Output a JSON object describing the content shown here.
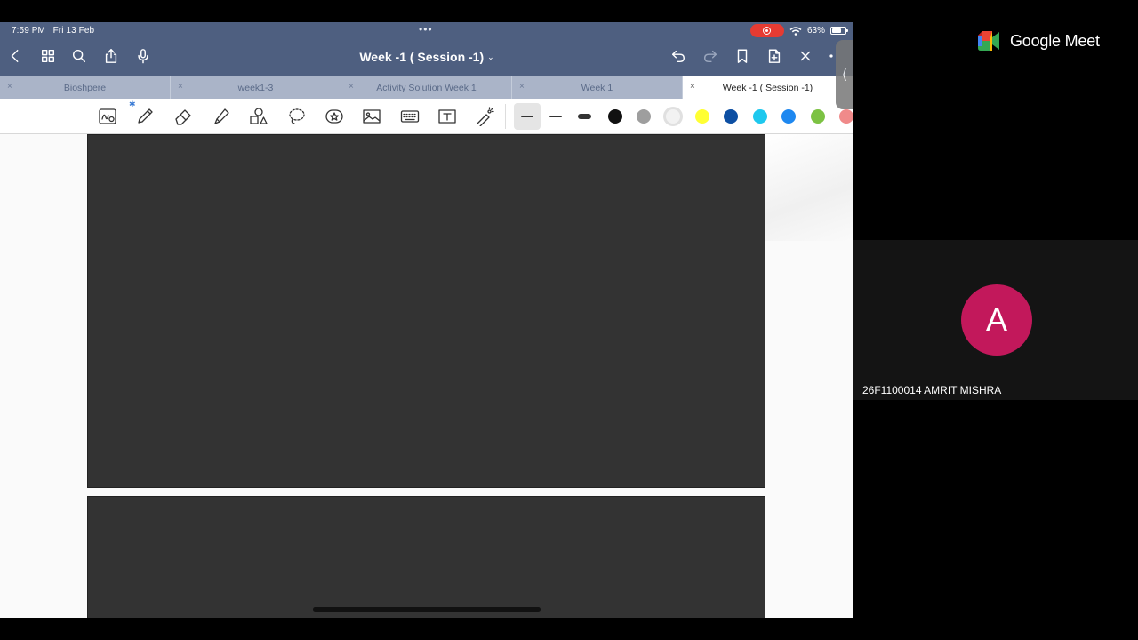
{
  "status_bar": {
    "time": "7:59 PM",
    "date": "Fri 13 Feb",
    "dots": "•••",
    "battery": "63%"
  },
  "nav": {
    "title": "Week -1 ( Session -1)",
    "title_chevron": "⌄",
    "icons": [
      "back-icon",
      "grid-icon",
      "search-icon",
      "share-icon",
      "mic-icon",
      "undo-icon",
      "redo-icon",
      "bookmark-icon",
      "add-page-icon",
      "close-icon",
      "more-icon"
    ]
  },
  "tabs": [
    {
      "label": "Bioshpere",
      "close": "×"
    },
    {
      "label": "week1-3",
      "close": "×"
    },
    {
      "label": "Activity Solution Week 1",
      "close": "×"
    },
    {
      "label": "Week 1",
      "close": "×"
    },
    {
      "label": "Week -1 ( Session -1)",
      "close": "×",
      "active": true
    }
  ],
  "toolbar": {
    "tools": [
      "handwriting-icon",
      "pen-icon",
      "eraser-icon",
      "highlighter-icon",
      "shapes-icon",
      "lasso-icon",
      "sticker-icon",
      "image-icon",
      "keyboard-icon",
      "text-box-icon",
      "laser-pointer-icon"
    ],
    "bluetooth": "✱",
    "colors": [
      "#111111",
      "#9e9e9e",
      "#f2f2f2",
      "#ffff33",
      "#0d4fa3",
      "#1ec8ee",
      "#1e88f0",
      "#7cc243",
      "#f08a8a"
    ]
  },
  "side_handle": "⟨",
  "meet": {
    "brand": "Google Meet",
    "participant_initial": "A",
    "participant_name": "26F1100014 AMRIT MISHRA",
    "avatar_color": "#c2185b"
  }
}
